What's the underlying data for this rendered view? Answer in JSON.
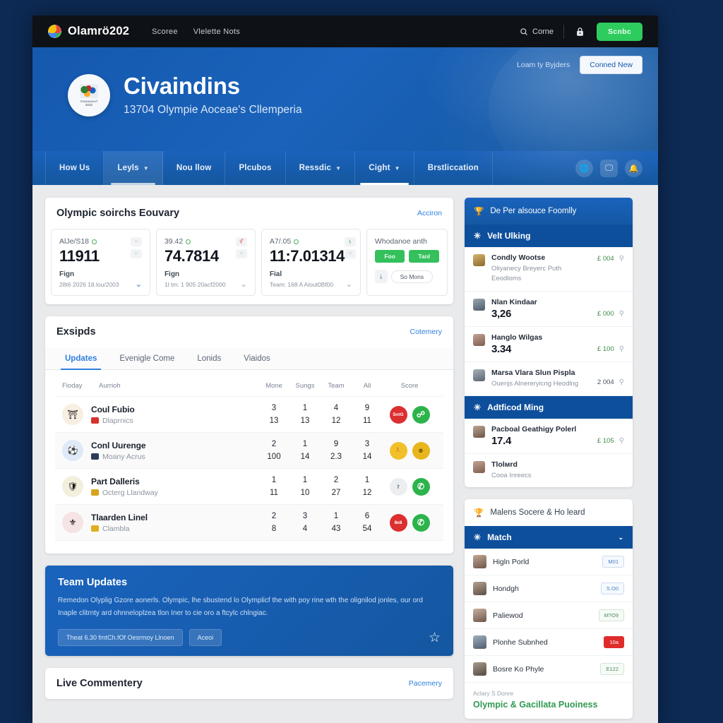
{
  "topbar": {
    "brand": "Olamrö202",
    "links": [
      "Scoree",
      "Vlelette Nots"
    ],
    "search_label": "Corne",
    "lock_icon": "lock-icon",
    "cta": "Scnbc"
  },
  "hero": {
    "loyalty_label": "Loam ty Byjders",
    "connect_button": "Conned New",
    "crest_line1": "Coosuscrl",
    "crest_line2": "2012",
    "title": "Civaindins",
    "subtitle": "13704 Olympie Aoceae's Cllemperia"
  },
  "nav": {
    "items": [
      {
        "label": "How Us",
        "caret": false,
        "state": "plain"
      },
      {
        "label": "Leyls",
        "caret": true,
        "state": "soft"
      },
      {
        "label": "Nou llow",
        "caret": false,
        "state": "plain"
      },
      {
        "label": "Plcubos",
        "caret": false,
        "state": "plain"
      },
      {
        "label": "Ressdic",
        "caret": true,
        "state": "plain"
      },
      {
        "label": "Cight",
        "caret": true,
        "state": "active"
      },
      {
        "label": "Brstliccation",
        "caret": false,
        "state": "plain"
      }
    ],
    "icons": [
      "globe-icon",
      "screen-icon",
      "bell-icon"
    ]
  },
  "summary": {
    "title": "Olympic soirchs Eouvary",
    "action": "Acciron",
    "stats": [
      {
        "label": "AlJe/S18",
        "value": "11911",
        "sub": "Fign",
        "foot": "28t6 2026 18.lou/2003",
        "mini1": "⁘",
        "mini2": "⁙",
        "chevron": "⌄"
      },
      {
        "label": "39.42",
        "value": "74.7814",
        "sub": "Fign",
        "foot": "1l tm: 1 905 20acf2000",
        "mini1": "⚥",
        "mini2": "⁙",
        "chevron": "⌄"
      },
      {
        "label": "A7/.05",
        "value": "11:7.01314",
        "sub": "Fial",
        "foot": "Team: 168 A Alout0Bf00",
        "mini1": "⚸",
        "mini2": "⁙",
        "chevron": "⌄"
      }
    ],
    "side": {
      "label": "Whodanoe anth",
      "pills": [
        "Foo",
        "Tanl"
      ],
      "see_icon": "download-icon",
      "see_more": "So Mons"
    }
  },
  "exsipds": {
    "title": "Exsipds",
    "action": "Cotemery",
    "tabs": [
      "Updates",
      "Evenigle Come",
      "Lonids",
      "Viaidos"
    ],
    "columns": [
      "Fioday",
      "Aurrioh",
      "Mone",
      "Sungs",
      "Team",
      "All",
      "Score"
    ],
    "rows": [
      {
        "crest": "⛩",
        "crest_bg": "#f6efe2",
        "name": "Coul Fubio",
        "sub": "Dlaprnics",
        "flag": "#d7322c",
        "n1a": "3",
        "n1b": "13",
        "n2a": "1",
        "n2b": "13",
        "n3a": "4",
        "n3b": "12",
        "n4a": "9",
        "n4b": "11",
        "badge1": "5nזG",
        "badge1_type": "red",
        "badge2": "☍",
        "badge2_type": "green"
      },
      {
        "crest": "⚽",
        "crest_bg": "#dfe9f7",
        "name": "Conl Uurenge",
        "sub": "Moany Acrus",
        "flag": "#2b3c55",
        "n1a": "2",
        "n1b": "100",
        "n2a": "1",
        "n2b": "14",
        "n3a": "9",
        "n3b": "2.3",
        "n4a": "3",
        "n4b": "14",
        "badge1": "⛹",
        "badge1_type": "yellow",
        "badge2": "◎",
        "badge2_type": "gold"
      },
      {
        "crest": "🛡",
        "crest_bg": "#f4efdd",
        "name": "Part Dalleris",
        "sub": "Octerg Llandway",
        "flag": "#d8a31f",
        "n1a": "1",
        "n1b": "11",
        "n2a": "1",
        "n2b": "10",
        "n3a": "2",
        "n3b": "27",
        "n4a": "1",
        "n4b": "12",
        "badge1": "ז",
        "badge1_type": "grey",
        "badge2": "✆",
        "badge2_type": "green"
      },
      {
        "crest": "⚜",
        "crest_bg": "#f6e3e3",
        "name": "Tlaarden Linel",
        "sub": "Clambla",
        "flag": "#e0b020",
        "n1a": "2",
        "n1b": "8",
        "n2a": "3",
        "n2b": "4",
        "n3a": "1",
        "n3b": "43",
        "n4a": "6",
        "n4b": "54",
        "badge1": "8ᴋ8",
        "badge1_type": "red",
        "badge2": "✆",
        "badge2_type": "green"
      }
    ]
  },
  "banner": {
    "title": "Team Updates",
    "body": "Remedon Olyplig Gzore aonerls. Olympic, lhe sbustend lo Olymplicf the with poy rine wth the olignilod jonles, our ord Inaple clitrnty ard ohnneloplzea tlon Iner to cie oro a ftcylc chlngiac.",
    "chips": [
      "Theat 6.30 fmtCh.fOf Oesrmoy Llnoen",
      "Aceoi"
    ],
    "star_icon": "star-icon"
  },
  "live": {
    "title": "Live Commentery",
    "action": "Pacemery"
  },
  "sidebar": {
    "panel1": {
      "head": "De Per alsouce Foomlly",
      "head_icon": "trophy-icon",
      "sub": "Velt Ulking",
      "sub_icon": "snowflake-icon",
      "items": [
        {
          "name": "Condly Wootse",
          "desc": "Oliyanecy Breyerc Puth Eeodloms",
          "value": "",
          "amount": "£ 004"
        },
        {
          "name": "Nlan Kindaar",
          "desc": "",
          "value": "3,26",
          "amount": "£ 000"
        },
        {
          "name": "Hanglo Wilgas",
          "desc": "",
          "value": "3.34",
          "amount": "£ 100"
        },
        {
          "name": "Marsa Vlara Slun Pisplа",
          "desc": "Ouenjs Alnereryicng Heodlng",
          "value": "",
          "amount": "2 004"
        }
      ],
      "sub2": "Adtficod Ming",
      "sub2_icon": "snowflake-icon",
      "items2": [
        {
          "name": "Pacboal Geathigy Polerl",
          "desc": "",
          "value": "17.4",
          "amount": "£ 105"
        },
        {
          "name": "Tlolмrd",
          "desc": "Cooa Inreecs",
          "value": "",
          "amount": ""
        }
      ]
    },
    "panel2": {
      "head": "Malens Socere & Ho leard",
      "head_icon": "trophy-icon",
      "sub": "Match",
      "sub_icon": "snowflake-icon",
      "chevron": "⌄",
      "rows": [
        {
          "name": "Higln Porld",
          "badge": "M01",
          "type": "blue"
        },
        {
          "name": "Hondgh",
          "badge": "S.O0",
          "type": "blue"
        },
        {
          "name": "Paliewod",
          "badge": "M?O9",
          "type": "grey"
        },
        {
          "name": "Plonhe Subnhed",
          "badge": "10a",
          "type": "red"
        },
        {
          "name": "Bosre Ko Phyle",
          "badge": "E122",
          "type": "grey"
        }
      ],
      "foot_label": "Aclary S Donre",
      "foot_value": "Olympic & Gacillata Puoiness"
    }
  }
}
